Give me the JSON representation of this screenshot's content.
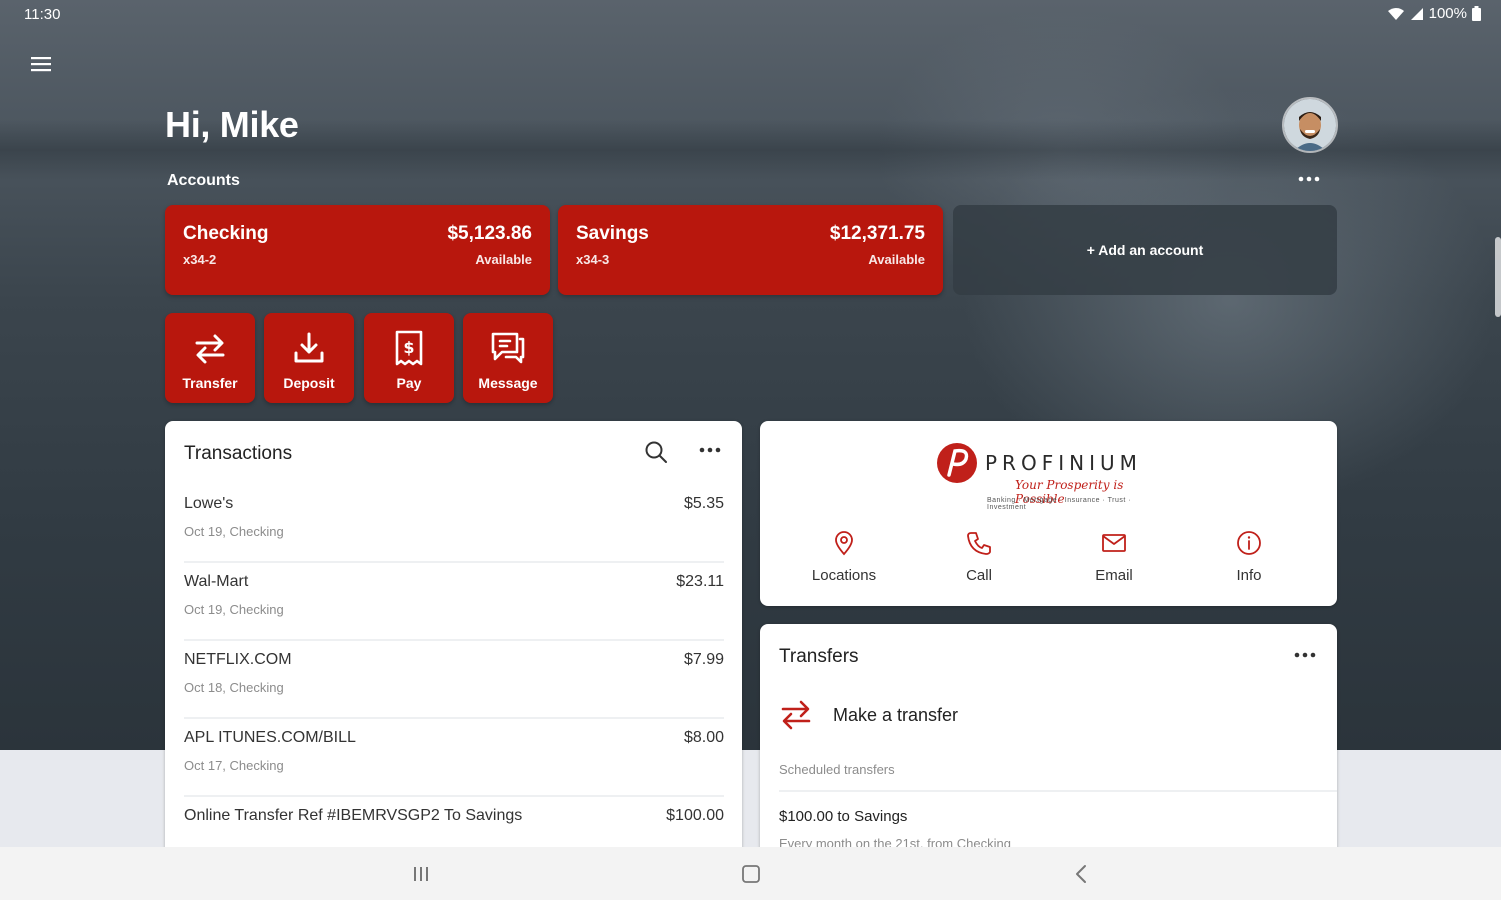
{
  "status_bar": {
    "time": "11:30",
    "battery": "100%"
  },
  "header": {
    "greeting": "Hi, Mike",
    "accounts_label": "Accounts"
  },
  "accounts": [
    {
      "name": "Checking",
      "number": "x34-2",
      "balance": "$5,123.86",
      "balance_label": "Available"
    },
    {
      "name": "Savings",
      "number": "x34-3",
      "balance": "$12,371.75",
      "balance_label": "Available"
    }
  ],
  "add_account_label": "+ Add an account",
  "actions": [
    {
      "label": "Transfer",
      "icon": "transfer-icon"
    },
    {
      "label": "Deposit",
      "icon": "download-icon"
    },
    {
      "label": "Pay",
      "icon": "dollar-receipt-icon"
    },
    {
      "label": "Message",
      "icon": "message-icon"
    }
  ],
  "transactions": {
    "title": "Transactions",
    "items": [
      {
        "description": "Lowe's",
        "meta": "Oct 19, Checking",
        "amount": "$5.35"
      },
      {
        "description": "Wal-Mart",
        "meta": "Oct 19, Checking",
        "amount": "$23.11"
      },
      {
        "description": "NETFLIX.COM",
        "meta": "Oct 18, Checking",
        "amount": "$7.99"
      },
      {
        "description": "APL ITUNES.COM/BILL",
        "meta": "Oct 17, Checking",
        "amount": "$8.00"
      },
      {
        "description": "Online Transfer Ref #IBEMRVSGP2 To Savings",
        "meta": "",
        "amount": "$100.00"
      }
    ]
  },
  "brand": {
    "name": "PROFINIUM",
    "tagline": "Your Prosperity is Possible",
    "services": "Banking · Mortgage · Insurance · Trust · Investment",
    "contacts": [
      {
        "label": "Locations",
        "icon": "location-pin-icon"
      },
      {
        "label": "Call",
        "icon": "phone-icon"
      },
      {
        "label": "Email",
        "icon": "envelope-icon"
      },
      {
        "label": "Info",
        "icon": "info-icon"
      }
    ]
  },
  "transfers": {
    "title": "Transfers",
    "make_transfer_label": "Make a transfer",
    "scheduled_label": "Scheduled transfers",
    "scheduled": [
      {
        "title": "$100.00 to Savings",
        "meta": "Every month on the 21st, from Checking"
      }
    ]
  },
  "colors": {
    "accent": "#b8170d",
    "panel": "#ffffff",
    "text": "#222222",
    "muted": "#8c8c8c"
  }
}
